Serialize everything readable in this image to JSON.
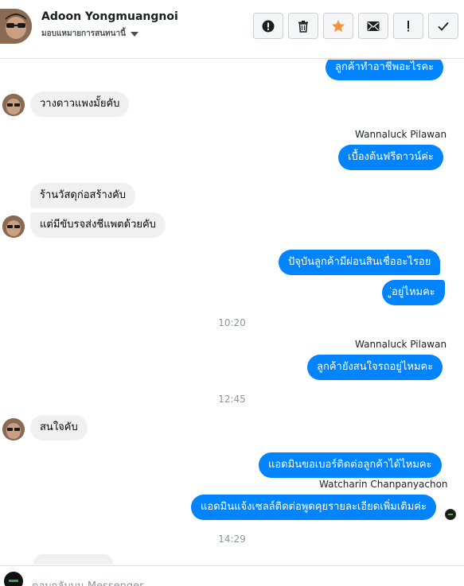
{
  "header": {
    "name": "Adoon Yongmuangnoi",
    "subtitle": "มอบแหมายการสนทนานี้"
  },
  "toolbar": {
    "buttons": [
      {
        "icon": "alert-circle-icon",
        "label": "report"
      },
      {
        "icon": "trash-icon",
        "label": "delete"
      },
      {
        "icon": "star-icon",
        "label": "star",
        "color": "#f7923a"
      },
      {
        "icon": "envelope-icon",
        "label": "mark unread"
      },
      {
        "icon": "exclamation-icon",
        "label": "mark spam"
      },
      {
        "icon": "checkmark-icon",
        "label": "mark done"
      }
    ]
  },
  "colors": {
    "outgoing_bubble": "#0084ff",
    "incoming_bubble": "#f1f0f0",
    "star": "#f7923a"
  },
  "messages": {
    "m1": "ลูกค้าทำอาชีพอะไรคะ",
    "m2": "วางดาวแพงมั้ยคับ",
    "s1": "Wannaluck Pilawan",
    "m3": "เบื้องต้นฟรีดาวน์ค่ะ",
    "m4": "ร้านวัสดุก่อสร้างคับ",
    "m5": "แต่มีขับรจส่งชีแพตด้วยคับ",
    "m6": "ปัจุบันลูกค้ามีผ่อนสินเชื่ออะไรอย",
    "m7": "ู่อยู่ไหมคะ",
    "t1": "10:20",
    "s2": "Wannaluck Pilawan",
    "m8": "ลูกค้ายังสนใจรถอยู่ไหมคะ",
    "t2": "12:45",
    "m9": "สนใจคับ",
    "m10": "แอดมินขอเบอร์ติดต่อลูกค้าได้ไหมคะ",
    "s3": "Watcharin Chanpanyachon",
    "m11": "แอดมินแจ้งเซลล์ติดต่อพูดคุยรายละเอียดเพิ่มเติมค่ะ",
    "t3": "14:29"
  },
  "composer": {
    "placeholder": "ตอบกลับบน Messenger"
  }
}
